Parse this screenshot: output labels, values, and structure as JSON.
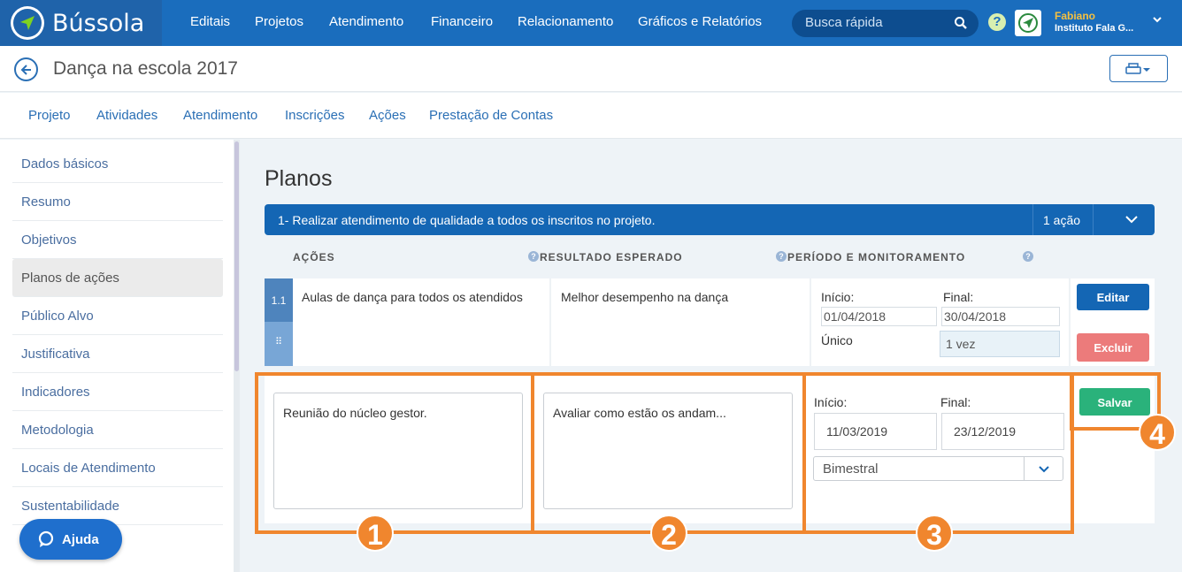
{
  "app": {
    "name": "Bússola"
  },
  "nav": {
    "items": [
      "Editais",
      "Projetos",
      "Atendimento",
      "Financeiro",
      "Relacionamento",
      "Gráficos e Relatórios"
    ]
  },
  "search": {
    "placeholder": "Busca rápida"
  },
  "user": {
    "name": "Fabiano",
    "org": "Instituto Fala G..."
  },
  "page": {
    "title": "Dança na escola 2017"
  },
  "tabs": [
    "Projeto",
    "Atividades",
    "Atendimento",
    "Inscrições",
    "Ações",
    "Prestação de Contas"
  ],
  "sidebar": {
    "items": [
      "Dados básicos",
      "Resumo",
      "Objetivos",
      "Planos de ações",
      "Público Alvo",
      "Justificativa",
      "Indicadores",
      "Metodologia",
      "Locais de Atendimento",
      "Sustentabilidade"
    ],
    "active": "Planos de ações"
  },
  "help_button": {
    "label": "Ajuda"
  },
  "section": {
    "title": "Planos"
  },
  "plan": {
    "title": "1- Realizar atendimento de qualidade a todos os inscritos no projeto.",
    "count": "1 ação"
  },
  "columns": {
    "acoes": "AÇÕES",
    "resultado": "RESULTADO ESPERADO",
    "periodo": "PERÍODO E MONITORAMENTO",
    "help": "?"
  },
  "action": {
    "number": "1.1",
    "handle": "⠿",
    "description": "Aulas de dança para todos os atendidos",
    "result": "Melhor desempenho na dança",
    "start_label": "Início:",
    "end_label": "Final:",
    "start": "01/04/2018",
    "end": "30/04/2018",
    "frequency_label": "Único",
    "frequency_value": "1 vez",
    "edit_label": "Editar",
    "delete_label": "Excluir"
  },
  "new_action": {
    "description": "Reunião do núcleo gestor.",
    "result": "Avaliar como estão os andam...",
    "start_label": "Início:",
    "end_label": "Final:",
    "start": "11/03/2019",
    "end": "23/12/2019",
    "frequency": "Bimestral",
    "save_label": "Salvar"
  },
  "callouts": [
    "1",
    "2",
    "3",
    "4"
  ],
  "colors": {
    "primary": "#1a6dbd",
    "highlight": "#f0862e",
    "save": "#2ab27b",
    "delete": "#ec7b7b"
  }
}
